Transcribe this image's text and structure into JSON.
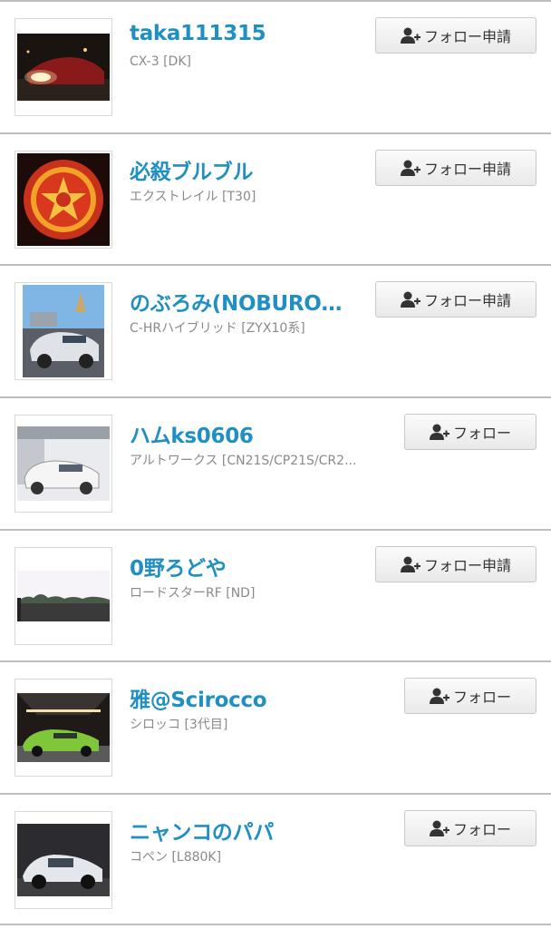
{
  "users": [
    {
      "name": "taka111315",
      "car": "CX-3 [DK]",
      "button": "フォロー申請",
      "button_type": "request",
      "thumb": "thumb-car-night-red"
    },
    {
      "name": "必殺ブルブル",
      "car": "エクストレイル [T30]",
      "button": "フォロー申請",
      "button_type": "request",
      "thumb": "thumb-emblem-red"
    },
    {
      "name": "のぶろみ(NOBUROM...",
      "car": "C-HRハイブリッド [ZYX10系]",
      "button": "フォロー申請",
      "button_type": "request",
      "thumb": "thumb-car-white-sky"
    },
    {
      "name": "ハムks0606",
      "car": "アルトワークス [CN21S/CP21S/CR2...",
      "button": "フォロー",
      "button_type": "follow",
      "thumb": "thumb-car-garage"
    },
    {
      "name": "0野ろどや",
      "car": "ロードスターRF [ND]",
      "button": "フォロー申請",
      "button_type": "request",
      "thumb": "thumb-landscape-trees"
    },
    {
      "name": "雅@Scirocco",
      "car": "シロッコ [3代目]",
      "button": "フォロー",
      "button_type": "follow",
      "thumb": "thumb-car-green-tunnel"
    },
    {
      "name": "ニャンコのパパ",
      "car": "コペン [L880K]",
      "button": "フォロー",
      "button_type": "follow",
      "thumb": "thumb-car-silver-dark"
    }
  ],
  "colors": {
    "name": "#1f8fc4",
    "subtext": "#8a8a8a",
    "divider": "#bdbdbd",
    "button_border": "#c8c8c8"
  },
  "icons": {
    "follow_button_icon": "add-user-icon"
  }
}
